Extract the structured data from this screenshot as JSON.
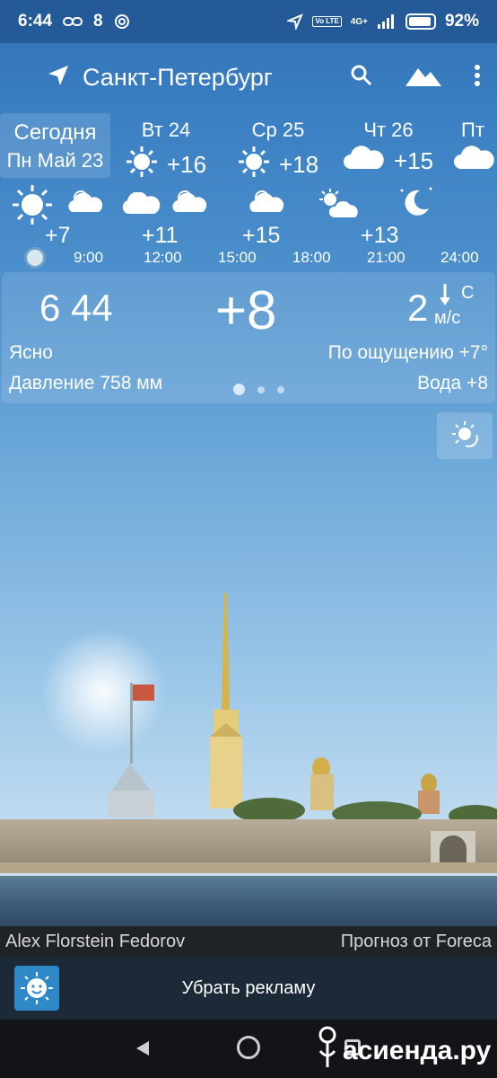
{
  "status_bar": {
    "time": "6:44",
    "temp_indicator": "8",
    "battery": "92%",
    "battery_level": 0.92,
    "net_badge_1": "Vo LTE",
    "net_badge_2": "4G+"
  },
  "toolbar": {
    "city": "Санкт-Петербург",
    "icons": [
      "location-arrow-icon",
      "search-icon",
      "landscape-icon",
      "more-vert-icon"
    ]
  },
  "days": [
    {
      "l1": "Сегодня",
      "l2": "Пн Май 23",
      "selected": true
    },
    {
      "name": "Вт 24",
      "temp": "+16",
      "icon": "sun-icon"
    },
    {
      "name": "Ср 25",
      "temp": "+18",
      "icon": "sun-icon"
    },
    {
      "name": "Чт 26",
      "temp": "+15",
      "icon": "cloud-icon"
    },
    {
      "name": "Пт",
      "temp": "",
      "icon": "cloud-icon"
    }
  ],
  "hourly": {
    "icons": [
      "sun-icon",
      "partly-cloudy-icon",
      "cloud-icon",
      "partly-cloudy-icon",
      "partly-cloudy-icon",
      "partly-cloudy-icon",
      "sun-cloud-icon",
      "moon-icon"
    ],
    "temps": [
      "+7",
      "+11",
      "+15",
      "+13"
    ],
    "times": [
      "9:00",
      "12:00",
      "15:00",
      "18:00",
      "21:00",
      "24:00"
    ]
  },
  "now": {
    "time": "6 44",
    "temp": "+8",
    "wind_speed": "2",
    "wind_dir": "С",
    "wind_unit": "м/с",
    "condition": "Ясно",
    "feels_like": "По ощущению +7°",
    "pressure": "Давление 758 мм",
    "water": "Вода +8"
  },
  "photo": {
    "author": "Alex Florstein Fedorov",
    "provider": "Прогноз от Foreca"
  },
  "ad": {
    "label": "Убрать рекламу"
  },
  "watermark": "асиенда.ру",
  "colors": {
    "status_bar": "#245a98",
    "sky_top": "#2f6fb4",
    "sky_bottom": "#c9e0ef",
    "ad_bar": "#1c2a38"
  }
}
